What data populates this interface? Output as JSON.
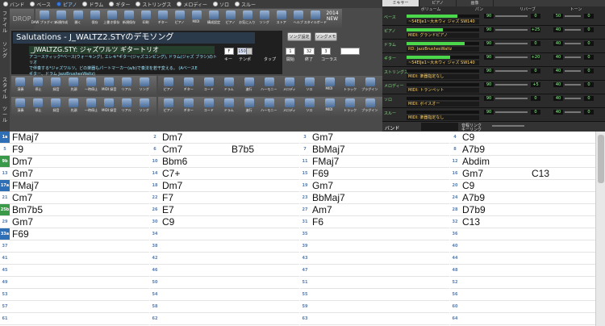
{
  "tracks": [
    {
      "label": "バンド",
      "selected": false
    },
    {
      "label": "ベース",
      "selected": false
    },
    {
      "label": "ピアノ",
      "selected": true
    },
    {
      "label": "ドラム",
      "selected": false
    },
    {
      "label": "ギター",
      "selected": false
    },
    {
      "label": "ストリングス",
      "selected": false
    },
    {
      "label": "メロディー",
      "selected": false
    },
    {
      "label": "ソロ",
      "selected": false
    },
    {
      "label": "スルー",
      "selected": false
    }
  ],
  "left_labels": [
    "ファイル",
    "ソング",
    "スタイル",
    "ツール"
  ],
  "drop_label": "DROP",
  "toolbar1": [
    "DAW プラグイン",
    "新規作成",
    "開く",
    "保存",
    "上書き保存",
    "新規保存",
    "印刷",
    "ギター",
    "ピアノ",
    "MIDI",
    "構成設定",
    "ピアノ",
    "お気に入り",
    "ソング",
    "ストア",
    "ヘルプ",
    "スタイルボード"
  ],
  "toolbar2": [
    "演奏",
    "停止",
    "録音",
    "先頭",
    "一時停止",
    "MIDI 録音",
    "リアル",
    "ソング"
  ],
  "toolbar3": [
    "ピアノ",
    "ギター",
    "コード",
    "ドラム",
    "進行",
    "ハーモニー",
    "メロディ",
    "ソロ",
    "MIDI",
    "トラック",
    "プラグイン"
  ],
  "version_label": "2014 NEW",
  "title": {
    "song": "Salutations - J_WALTZ2.STYのデモソング",
    "style": "_JWALTZG.STY: ジャズワルツ ギタートリオ",
    "desc_line1": "アコースティック*ベース(ウォーキング), エレキ*ギター(ジャズコンピング), ドラム(ジャズ ブラシ)のトリオ",
    "desc_line2": "で伴奏する*ジャズワルツ。どの楽器もパートマーカー(a/b)で奏法を若干変える。 (AベースE",
    "desc_line3": "ギター、ドラム JazzBrushesWaltz)"
  },
  "song_buttons": {
    "song_settings": "ソング設定",
    "song_memo": "ソングメモ"
  },
  "transport": {
    "key_label": "キー",
    "key": "F",
    "tempo_label": "テンポ",
    "tempo": "150",
    "tap_label": "タップ",
    "start_label": "開始",
    "start": "1",
    "end_label": "終了",
    "end": "32",
    "chorus_label": "コーラス",
    "chorus": "3"
  },
  "mixer": {
    "tabs": [
      "ミキサー",
      "ピアノ",
      "画像"
    ],
    "headers": [
      "ボリューム",
      "パン",
      "リバーブ",
      "トーン"
    ],
    "rows": [
      {
        "name": "ベース",
        "inst": "~54EIJe1~大木ウィ ジャズ SW140",
        "level": 0.7,
        "vol": "90",
        "pan": "0",
        "rev": "50",
        "tone": "0"
      },
      {
        "name": "ピアノ",
        "inst": "MIDI: グランドピアノ",
        "level": 0.5,
        "vol": "90",
        "pan": "+25",
        "rev": "40",
        "tone": "0"
      },
      {
        "name": "ドラム",
        "inst": "RD: JazzBrushesWaltz",
        "level": 0.8,
        "vol": "90",
        "pan": "0",
        "rev": "40",
        "tone": "0"
      },
      {
        "name": "ギター",
        "inst": "~54EIJe1~大木ウィ ジャズ SW140",
        "level": 0.6,
        "vol": "90",
        "pan": "+20",
        "rev": "40",
        "tone": "0"
      },
      {
        "name": "ストリングス",
        "inst": "MIDI: 楽器指定なし",
        "level": 0.0,
        "vol": "90",
        "pan": "0",
        "rev": "40",
        "tone": "0"
      },
      {
        "name": "メロディー",
        "inst": "MIDI: トランペット",
        "level": 0.0,
        "vol": "90",
        "pan": "+5",
        "rev": "40",
        "tone": "0"
      },
      {
        "name": "ソロ",
        "inst": "MIDI: ボイスオー",
        "level": 0.0,
        "vol": "90",
        "pan": "0",
        "rev": "40",
        "tone": "0"
      },
      {
        "name": "スルー",
        "inst": "MIDI: 楽器指定なし",
        "level": 0.0,
        "vol": "90",
        "pan": "0",
        "rev": "40",
        "tone": "0"
      }
    ],
    "band_label": "バンド",
    "band_sub1": "音程リンク",
    "band_sub2": "キーリンク"
  },
  "chord_columns": [
    [
      {
        "bar": "1a",
        "part": "b",
        "chords": [
          "FMaj7"
        ]
      },
      {
        "bar": "5",
        "part": "",
        "chords": [
          "F9"
        ]
      },
      {
        "bar": "9b",
        "part": "g",
        "chords": [
          "Dm7"
        ]
      },
      {
        "bar": "13",
        "part": "",
        "chords": [
          "Gm7"
        ]
      },
      {
        "bar": "17a",
        "part": "b",
        "chords": [
          "FMaj7"
        ]
      },
      {
        "bar": "21",
        "part": "",
        "chords": [
          "Cm7"
        ]
      },
      {
        "bar": "25b",
        "part": "g",
        "chords": [
          "Bm7b5"
        ]
      },
      {
        "bar": "29",
        "part": "",
        "chords": [
          "Gm7"
        ]
      },
      {
        "bar": "33a",
        "part": "b",
        "chords": [
          "F69"
        ]
      },
      {
        "bar": "37",
        "part": "",
        "chords": []
      },
      {
        "bar": "41",
        "part": "",
        "chords": []
      },
      {
        "bar": "45",
        "part": "",
        "chords": []
      },
      {
        "bar": "49",
        "part": "",
        "chords": []
      },
      {
        "bar": "53",
        "part": "",
        "chords": []
      },
      {
        "bar": "57",
        "part": "",
        "chords": []
      },
      {
        "bar": "61",
        "part": "",
        "chords": []
      }
    ],
    [
      {
        "bar": "2",
        "part": "",
        "chords": [
          "Dm7"
        ]
      },
      {
        "bar": "6",
        "part": "",
        "chords": [
          "Cm7",
          "B7b5"
        ]
      },
      {
        "bar": "10",
        "part": "",
        "chords": [
          "Bbm6"
        ]
      },
      {
        "bar": "14",
        "part": "",
        "chords": [
          "C7+"
        ]
      },
      {
        "bar": "18",
        "part": "",
        "chords": [
          "Dm7"
        ]
      },
      {
        "bar": "22",
        "part": "",
        "chords": [
          "F7"
        ]
      },
      {
        "bar": "26",
        "part": "",
        "chords": [
          "E7"
        ]
      },
      {
        "bar": "30",
        "part": "",
        "chords": [
          "C9"
        ]
      },
      {
        "bar": "34",
        "part": "",
        "chords": []
      },
      {
        "bar": "38",
        "part": "",
        "chords": []
      },
      {
        "bar": "42",
        "part": "",
        "chords": []
      },
      {
        "bar": "46",
        "part": "",
        "chords": []
      },
      {
        "bar": "50",
        "part": "",
        "chords": []
      },
      {
        "bar": "54",
        "part": "",
        "chords": []
      },
      {
        "bar": "58",
        "part": "",
        "chords": []
      },
      {
        "bar": "62",
        "part": "",
        "chords": []
      }
    ],
    [
      {
        "bar": "3",
        "part": "",
        "chords": [
          "Gm7"
        ]
      },
      {
        "bar": "7",
        "part": "",
        "chords": [
          "BbMaj7"
        ]
      },
      {
        "bar": "11",
        "part": "",
        "chords": [
          "FMaj7"
        ]
      },
      {
        "bar": "15",
        "part": "",
        "chords": [
          "F69"
        ]
      },
      {
        "bar": "19",
        "part": "",
        "chords": [
          "Gm7"
        ]
      },
      {
        "bar": "23",
        "part": "",
        "chords": [
          "BbMaj7"
        ]
      },
      {
        "bar": "27",
        "part": "",
        "chords": [
          "Am7"
        ]
      },
      {
        "bar": "31",
        "part": "",
        "chords": [
          "F6"
        ]
      },
      {
        "bar": "35",
        "part": "",
        "chords": []
      },
      {
        "bar": "39",
        "part": "",
        "chords": []
      },
      {
        "bar": "43",
        "part": "",
        "chords": []
      },
      {
        "bar": "47",
        "part": "",
        "chords": []
      },
      {
        "bar": "51",
        "part": "",
        "chords": []
      },
      {
        "bar": "55",
        "part": "",
        "chords": []
      },
      {
        "bar": "59",
        "part": "",
        "chords": []
      },
      {
        "bar": "63",
        "part": "",
        "chords": []
      }
    ],
    [
      {
        "bar": "4",
        "part": "",
        "chords": [
          "C9"
        ]
      },
      {
        "bar": "8",
        "part": "",
        "chords": [
          "A7b9"
        ]
      },
      {
        "bar": "12",
        "part": "",
        "chords": [
          "Abdim"
        ]
      },
      {
        "bar": "16",
        "part": "",
        "chords": [
          "Gm7",
          "C13"
        ]
      },
      {
        "bar": "20",
        "part": "",
        "chords": [
          "C9"
        ]
      },
      {
        "bar": "24",
        "part": "",
        "chords": [
          "A7b9"
        ]
      },
      {
        "bar": "28",
        "part": "",
        "chords": [
          "D7b9"
        ]
      },
      {
        "bar": "32",
        "part": "",
        "chords": [
          "C13"
        ]
      },
      {
        "bar": "36",
        "part": "",
        "chords": []
      },
      {
        "bar": "40",
        "part": "",
        "chords": []
      },
      {
        "bar": "44",
        "part": "",
        "chords": []
      },
      {
        "bar": "48",
        "part": "",
        "chords": []
      },
      {
        "bar": "52",
        "part": "",
        "chords": []
      },
      {
        "bar": "56",
        "part": "",
        "chords": []
      },
      {
        "bar": "60",
        "part": "",
        "chords": []
      },
      {
        "bar": "64",
        "part": "",
        "chords": []
      }
    ]
  ]
}
